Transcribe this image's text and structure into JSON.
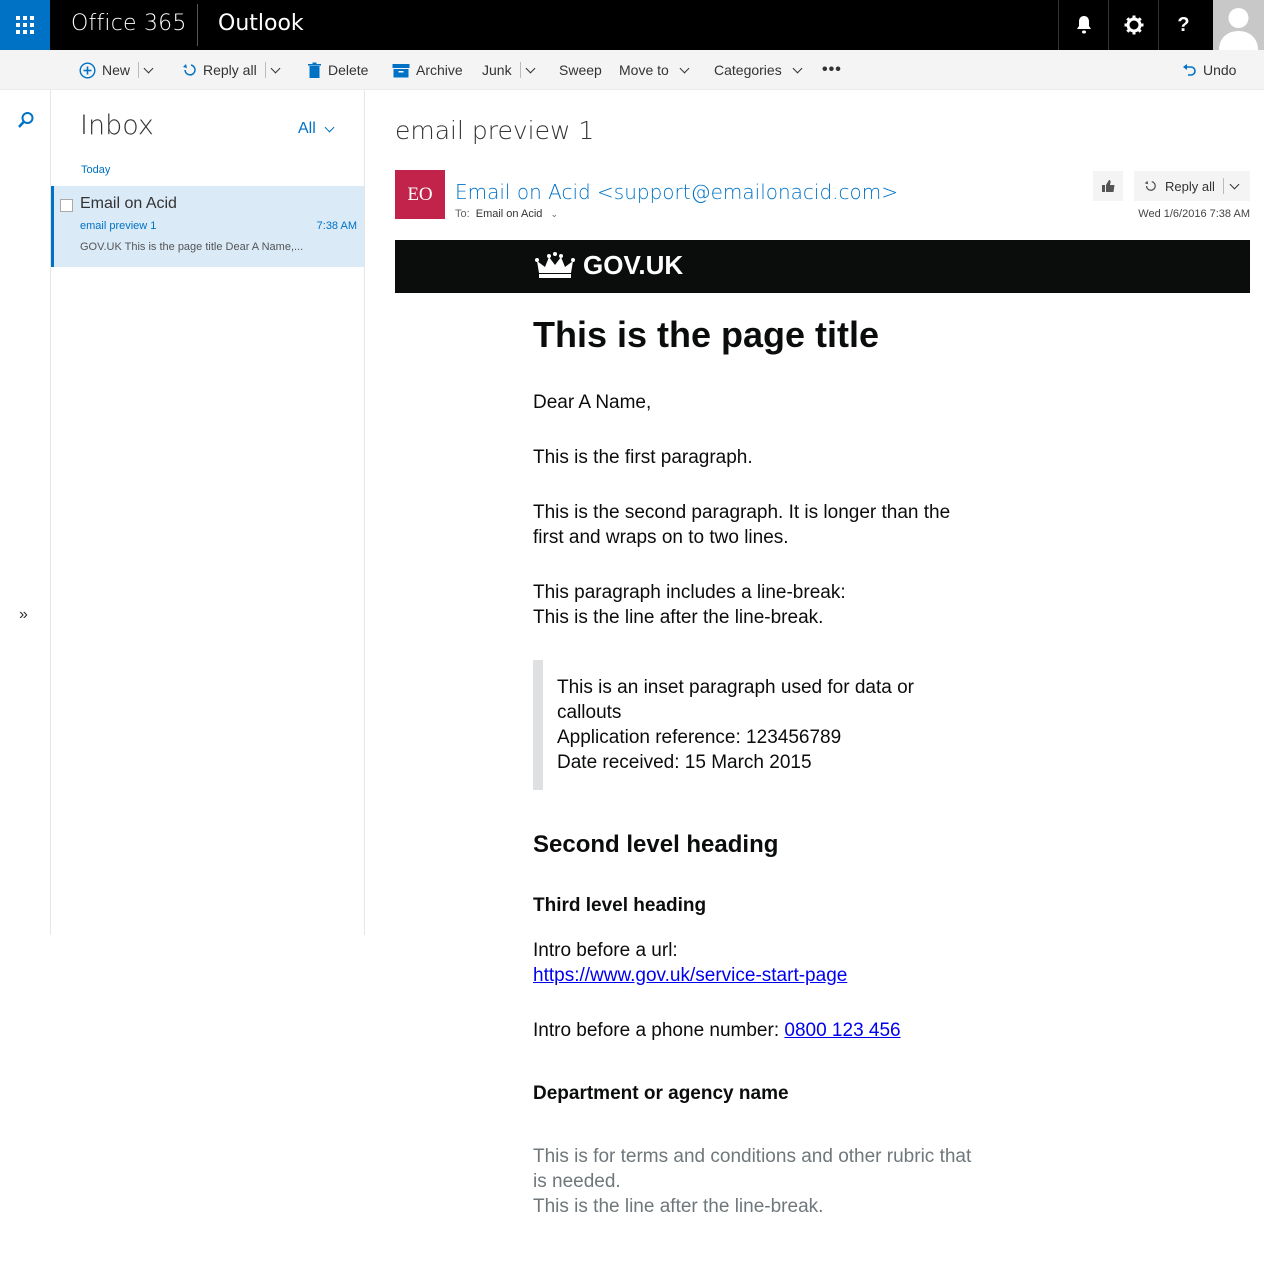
{
  "topbar": {
    "brand": "Office 365",
    "app": "Outlook"
  },
  "commands": {
    "new": "New",
    "reply_all": "Reply all",
    "delete": "Delete",
    "archive": "Archive",
    "junk": "Junk",
    "sweep": "Sweep",
    "move_to": "Move to",
    "categories": "Categories",
    "undo": "Undo"
  },
  "list": {
    "title": "Inbox",
    "filter": "All",
    "group": "Today",
    "items": [
      {
        "from": "Email on Acid",
        "subject": "email preview 1",
        "time": "7:38 AM",
        "preview": "GOV.UK  This is the page title  Dear A Name,..."
      }
    ]
  },
  "message": {
    "subject": "email preview 1",
    "sender_initials": "EO",
    "sender": "Email on Acid <support@emailonacid.com>",
    "to_label": "To:",
    "to": "Email on Acid",
    "reply_all": "Reply all",
    "date": "Wed 1/6/2016 7:38 AM",
    "accent": "#c1234b"
  },
  "email": {
    "logo_text": "GOV.UK",
    "page_title": "This is the page title",
    "greeting": "Dear A Name,",
    "para1": "This is the first paragraph.",
    "para2": "This is the second paragraph. It is longer than the first and wraps on to two lines.",
    "para3_line1": "This paragraph includes a line-break:",
    "para3_line2": "This is the line after the line-break.",
    "inset_line1": "This is an inset paragraph used for data or callouts",
    "inset_line2": "Application reference: 123456789",
    "inset_line3": "Date received: 15 March 2015",
    "h2": "Second level heading",
    "h3": "Third level heading",
    "url_intro": "Intro before a url:",
    "url": "https://www.gov.uk/service-start-page",
    "phone_intro": "Intro before a phone number: ",
    "phone": "0800 123 456",
    "department": "Department or agency name",
    "rubric_line1": "This is for terms and conditions and other rubric that is needed.",
    "rubric_line2": "This is the line after the line-break."
  },
  "colors": {
    "brand_blue": "#0072c6",
    "selected_bg": "#daeaf7",
    "gov_black": "#0b0c0c"
  }
}
